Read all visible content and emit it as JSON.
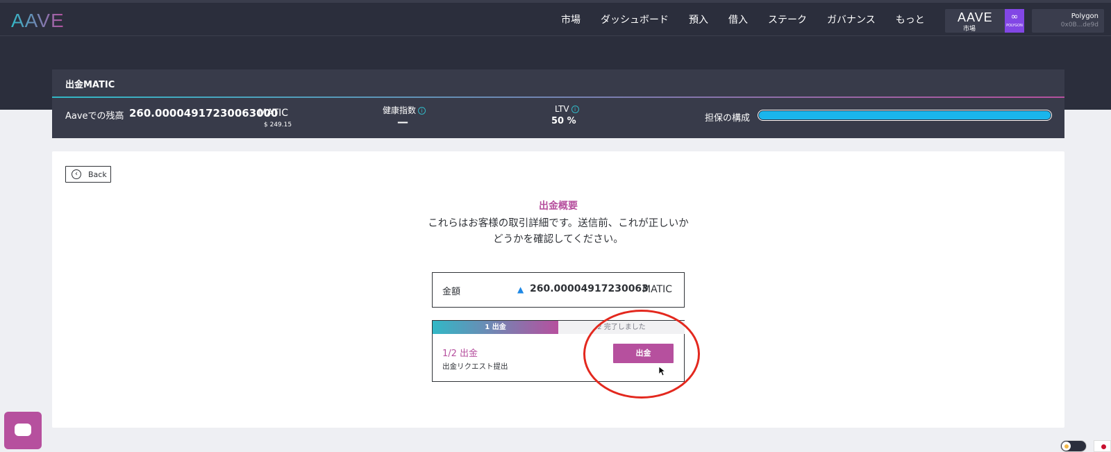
{
  "header": {
    "logo": "AAVE",
    "nav": [
      "市場",
      "ダッシュボード",
      "預入",
      "借入",
      "ステーク",
      "ガバナンス",
      "もっと"
    ],
    "market": {
      "logo": "AAVE",
      "label": "市場",
      "badge_text": "POLYGON"
    },
    "wallet": {
      "network": "Polygon",
      "address": "0x0B...de9d"
    }
  },
  "summary": {
    "title": "出金MATIC",
    "balance_label": "Aaveでの残高",
    "balance_value": "260.00004917230063000",
    "balance_unit": "MATIC",
    "balance_usd": "$ 249.15",
    "health_label": "健康指数",
    "health_value": "—",
    "ltv_label": "LTV",
    "ltv_value": "50 %",
    "collateral_label": "担保の構成",
    "collateral_fraction": 1.0,
    "collateral_color": "#1ab5ec"
  },
  "main": {
    "back_label": "Back",
    "title": "出金概要",
    "description": "これらはお客様の取引詳細です。送信前、これが正しいかどうかを確認してください。",
    "amount_label": "金額",
    "amount_value": "260.00004917230063",
    "amount_unit": "MATIC",
    "token_icon": "matic-icon",
    "steps": [
      {
        "label": "1 出金",
        "active": true
      },
      {
        "label": "2 完了しました",
        "active": false
      }
    ],
    "step_title": "1/2 出金",
    "step_desc": "出金リクエスト提出",
    "withdraw_button": "出金"
  },
  "colors": {
    "brand_pink": "#b6509e",
    "brand_teal": "#32b8c6",
    "header_bg": "#2b2e3c",
    "highlight_ring": "#e3281e"
  }
}
